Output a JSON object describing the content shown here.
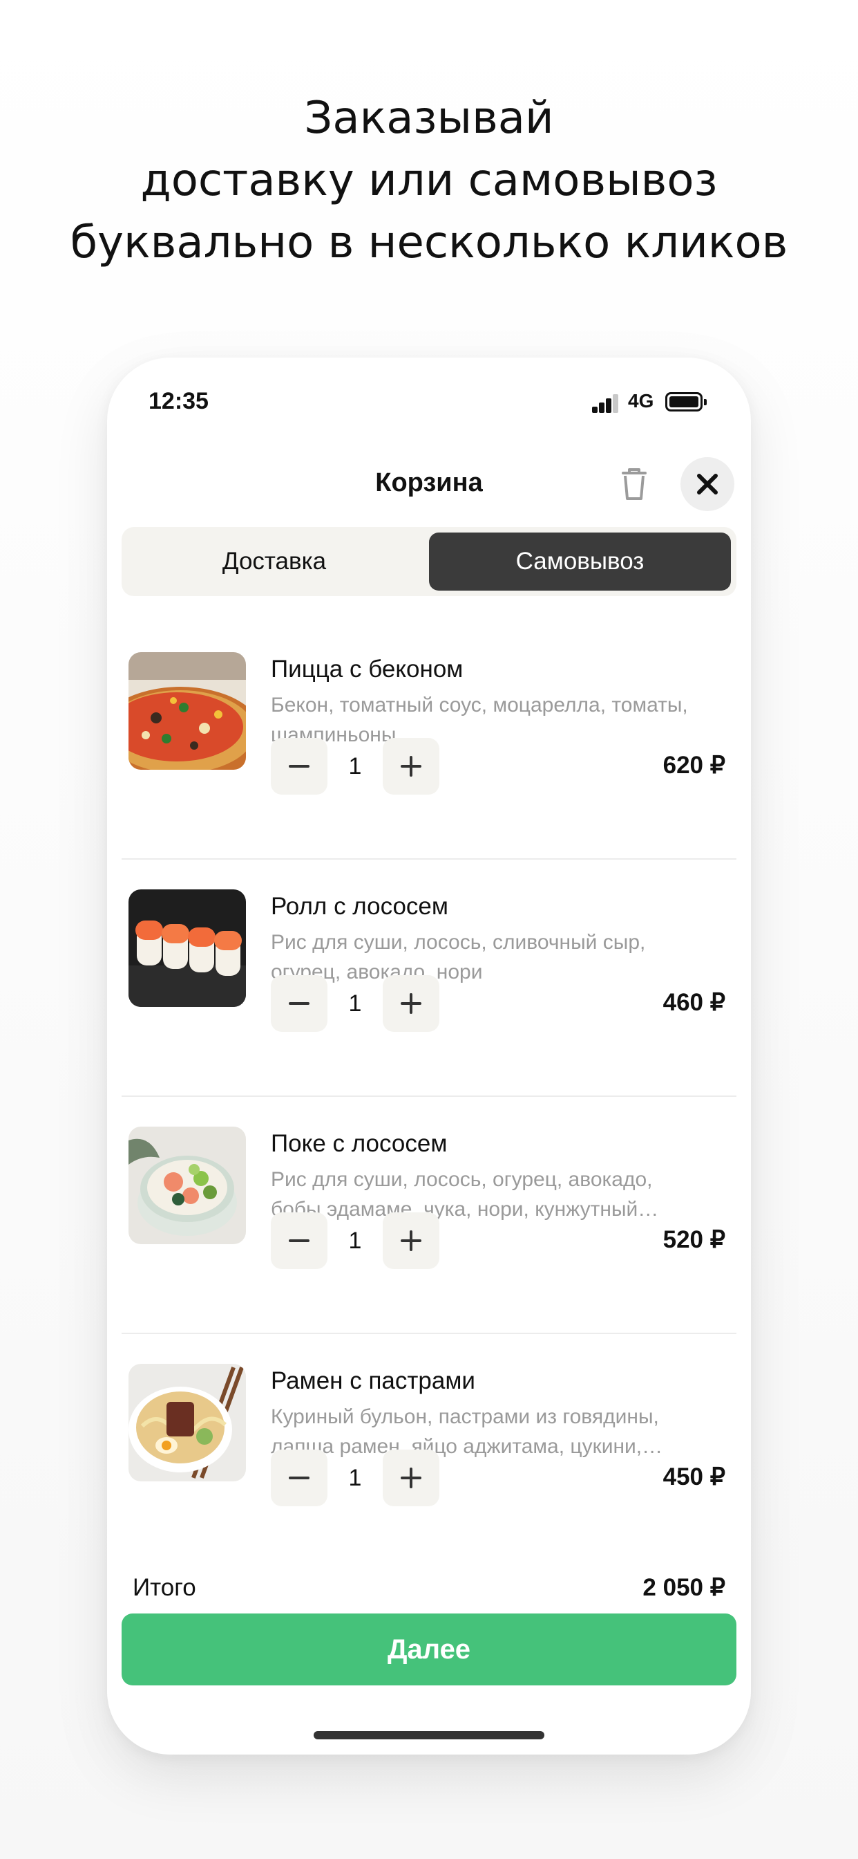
{
  "headline": {
    "lines": [
      "Заказывай",
      "доставку или самовывоз",
      "буквально в несколько кликов"
    ]
  },
  "status_bar": {
    "time": "12:35",
    "network": "4G"
  },
  "header": {
    "title": "Корзина",
    "trash_icon": "trash-icon",
    "close_icon": "close-icon"
  },
  "tabs": [
    {
      "label": "Доставка",
      "selected": false
    },
    {
      "label": "Самовывоз",
      "selected": true
    }
  ],
  "items": [
    {
      "name": "Пицца с беконом",
      "desc_line1": "Бекон, томатный соус, моцарелла, томаты,",
      "desc_line2": "шампиньоны",
      "qty": "1",
      "price": "620 ₽",
      "image": "pizza"
    },
    {
      "name": "Ролл с лососем",
      "desc_line1": "Рис для суши, лосось, сливочный сыр,",
      "desc_line2": "огурец, авокадо, нори",
      "qty": "1",
      "price": "460 ₽",
      "image": "salmon-roll"
    },
    {
      "name": "Поке с лососем",
      "desc_line1": "Рис для суши, лосось, огурец, авокадо,",
      "desc_line2": "бобы эдамаме, чука, нори, кунжутный…",
      "qty": "1",
      "price": "520 ₽",
      "image": "poke-bowl"
    },
    {
      "name": "Рамен с пастрами",
      "desc_line1": "Куриный бульон, пастрами из говядины,",
      "desc_line2": "лапша рамен, яйцо аджитама, цукини,…",
      "qty": "1",
      "price": "450 ₽",
      "image": "ramen-bowl"
    }
  ],
  "footer": {
    "total_label": "Итого",
    "total_value": "2 050 ₽",
    "next_label": "Далее"
  },
  "colors": {
    "accent": "#45c27a",
    "segment_selected": "#3b3b3b",
    "segment_bg": "#f4f3ef",
    "muted_text": "#9a9a9a"
  }
}
